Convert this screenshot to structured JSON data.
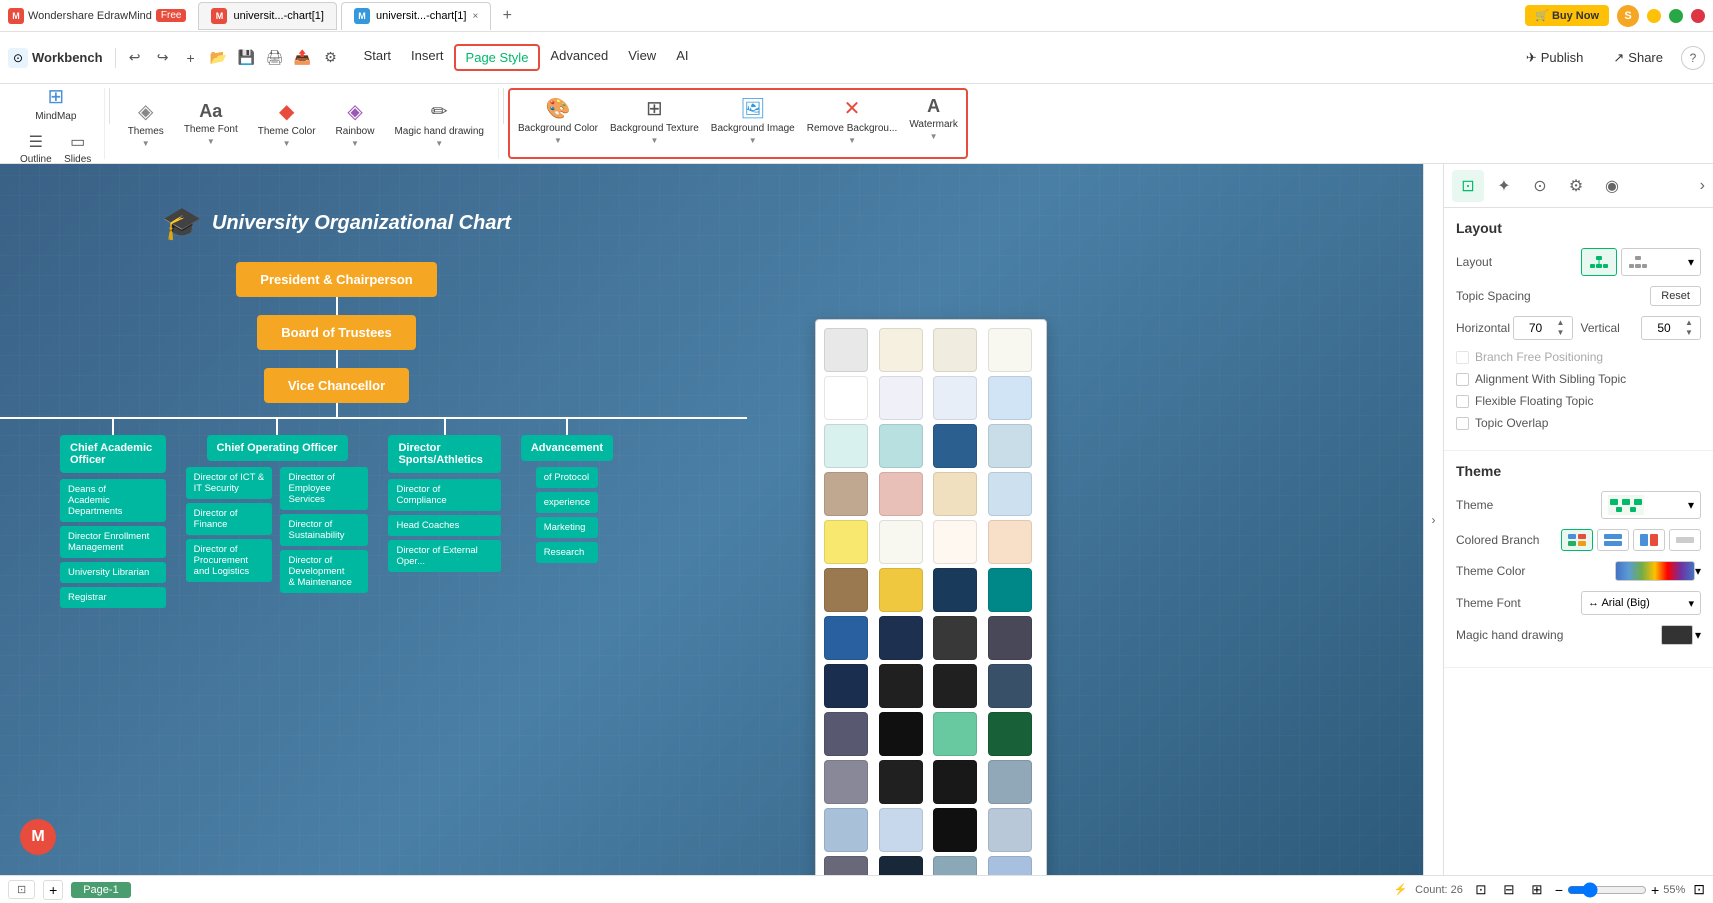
{
  "titleBar": {
    "brand": "M",
    "appName": "Wondershare EdrawMind",
    "badge": "Free",
    "tabs": [
      {
        "id": "tab1",
        "icon": "M",
        "iconColor": "#e74c3c",
        "title": "universit...-chart[1]",
        "active": false,
        "hasClose": false
      },
      {
        "id": "tab2",
        "icon": "M",
        "iconColor": "#3498db",
        "title": "universit...-chart[1]",
        "active": true,
        "hasClose": true
      }
    ],
    "buyNow": "🛒 Buy Now",
    "userInitial": "S"
  },
  "toolbar": {
    "workbench": "Workbench",
    "undoIcon": "↩",
    "redoIcon": "↪",
    "addIcon": "+",
    "navItems": [
      {
        "id": "start",
        "label": "Start",
        "active": false
      },
      {
        "id": "insert",
        "label": "Insert",
        "active": false
      },
      {
        "id": "pageStyle",
        "label": "Page Style",
        "active": true
      },
      {
        "id": "advanced",
        "label": "Advanced",
        "active": false
      },
      {
        "id": "view",
        "label": "View",
        "active": false
      },
      {
        "id": "ai",
        "label": "AI",
        "active": false
      }
    ],
    "publish": "Publish",
    "share": "Share",
    "help": "?"
  },
  "ribbon": {
    "groups": [
      {
        "id": "view",
        "items": [
          {
            "id": "mindmap",
            "icon": "⊞",
            "label": "MindMap"
          },
          {
            "id": "outline",
            "icon": "☰",
            "label": "Outline"
          },
          {
            "id": "slides",
            "icon": "▭",
            "label": "Slides"
          }
        ]
      },
      {
        "id": "style",
        "items": [
          {
            "id": "themes",
            "icon": "◈",
            "label": "Themes",
            "hasArrow": true
          },
          {
            "id": "themeFont",
            "icon": "Aa",
            "label": "Theme Font",
            "hasArrow": true
          },
          {
            "id": "themeColor",
            "icon": "◆",
            "label": "Theme Color",
            "hasArrow": true
          },
          {
            "id": "rainbow",
            "icon": "◈",
            "label": "Rainbow",
            "hasArrow": true
          },
          {
            "id": "magicHand",
            "icon": "✏",
            "label": "Magic hand drawing",
            "hasArrow": true
          }
        ]
      },
      {
        "id": "background",
        "highlighted": true,
        "items": [
          {
            "id": "bgColor",
            "icon": "🎨",
            "label": "Background Color",
            "hasArrow": true
          },
          {
            "id": "bgTexture",
            "icon": "⊞",
            "label": "Background Texture",
            "hasArrow": true
          },
          {
            "id": "bgImage",
            "icon": "🖼",
            "label": "Background Image",
            "hasArrow": true
          },
          {
            "id": "removeBg",
            "icon": "✕",
            "label": "Remove Backgrou...",
            "hasArrow": true
          },
          {
            "id": "watermark",
            "icon": "A",
            "label": "Watermark",
            "hasArrow": true
          }
        ]
      }
    ]
  },
  "chart": {
    "title": "University Organizational Chart",
    "capIcon": "🎓",
    "nodes": {
      "president": "President & Chairperson",
      "boardOfTrustees": "Board of Trustees",
      "viceChancellor": "Vice Chancellor",
      "chiefAcademic": "Chief Academic Officer",
      "chiefOperating": "Chief Operating Officer",
      "directorSports": "Director Sports/Athletics",
      "advancement": "Advancement",
      "deansAcademic": "Deans of\nAcademic Departments",
      "directorEnrollment": "Director Enrollment\nManagement",
      "universityLibrarian": "University Librarian",
      "registrar": "Registrar",
      "directorICT": "Director of ICT &\nIT Security",
      "directorFinance": "Director of Finance",
      "directorProcurement": "Director of Procurement\nand Logistics",
      "directorEmployee": "Directtor of\nEmployee Services",
      "directorSustainability": "Director of Sustainability",
      "directorDevelopment": "Director of Development\n& Maintenance",
      "directorCompliance": "Director of Compliance",
      "headCoaches": "Head Coaches",
      "directorExternal": "Director of External Oper...",
      "protocol": "of Protocol",
      "experience": "experience",
      "marketing": "Marketing",
      "research": "Research"
    }
  },
  "colorPicker": {
    "swatches": [
      "#e8e8e8",
      "#f5f0e8",
      "#f0ede0",
      "#f8f8f0",
      "#ffffff",
      "#f0f0f8",
      "#e8f0f8",
      "#d0e8f8",
      "#e0f0f0",
      "#c8e8e8",
      "#2a5f8a",
      "#d0e0e8",
      "#c8b8a8",
      "#e8c8c0",
      "#f0e0c8",
      "#d8e8f8",
      "#f8e880",
      "#f8f8f8",
      "#fff8f0",
      "#f8e8d8",
      "#a08060",
      "#f0c860",
      "#1a3a5c",
      "#008080",
      "#3060a0",
      "#203050",
      "#404040",
      "#505060",
      "#1a3050",
      "#282828",
      "#282828",
      "#3a5070",
      "#606060",
      "#181818",
      "#70c8a8",
      "#1a6040",
      "#9090a0",
      "#282828",
      "#202020",
      "#9ab0c0",
      "#b0c8e0",
      "#d0e0f0",
      "#181818",
      "#c8d8e8",
      "#707080",
      "#1a2a3a",
      "#9ab0c0",
      "#b0c8e8"
    ]
  },
  "rightPanel": {
    "tabs": [
      {
        "id": "layout",
        "icon": "⊡",
        "active": true
      },
      {
        "id": "style",
        "icon": "✦",
        "active": false
      },
      {
        "id": "location",
        "icon": "📍",
        "active": false
      },
      {
        "id": "settings",
        "icon": "⚙",
        "active": false
      },
      {
        "id": "magic",
        "icon": "🔮",
        "active": false
      }
    ],
    "layout": {
      "sectionTitle": "Layout",
      "layoutLabel": "Layout",
      "topicSpacingLabel": "Topic Spacing",
      "resetLabel": "Reset",
      "horizontalLabel": "Horizontal",
      "horizontalValue": "70",
      "verticalLabel": "Vertical",
      "verticalValue": "50",
      "checkboxes": [
        {
          "id": "branchFree",
          "label": "Branch Free Positioning",
          "checked": false,
          "disabled": true
        },
        {
          "id": "alignSibling",
          "label": "Alignment With Sibling Topic",
          "checked": false,
          "disabled": false
        },
        {
          "id": "flexibleFloat",
          "label": "Flexible Floating Topic",
          "checked": false,
          "disabled": false
        },
        {
          "id": "topicOverlap",
          "label": "Topic Overlap",
          "checked": false,
          "disabled": false
        }
      ]
    },
    "theme": {
      "sectionTitle": "Theme",
      "themeLabel": "Theme",
      "coloredBranchLabel": "Colored Branch",
      "coloredBranchOptions": [
        "⊞",
        "⊞",
        "⊞",
        "⊞"
      ],
      "themeColorLabel": "Theme Color",
      "themeFontLabel": "Theme Font",
      "themeFontValue": "↔ Arial (Big)",
      "magicHandLabel": "Magic hand drawing"
    }
  },
  "statusBar": {
    "pageIcon": "⊡",
    "addPage": "+",
    "pageName": "Page-1",
    "countIcon": "⚡",
    "countLabel": "Count: 26",
    "icons": [
      "⊡",
      "⊟",
      "⊞"
    ],
    "zoomOut": "−",
    "zoomLevel": "55%",
    "zoomIn": "+",
    "fullscreen": "⊡"
  }
}
